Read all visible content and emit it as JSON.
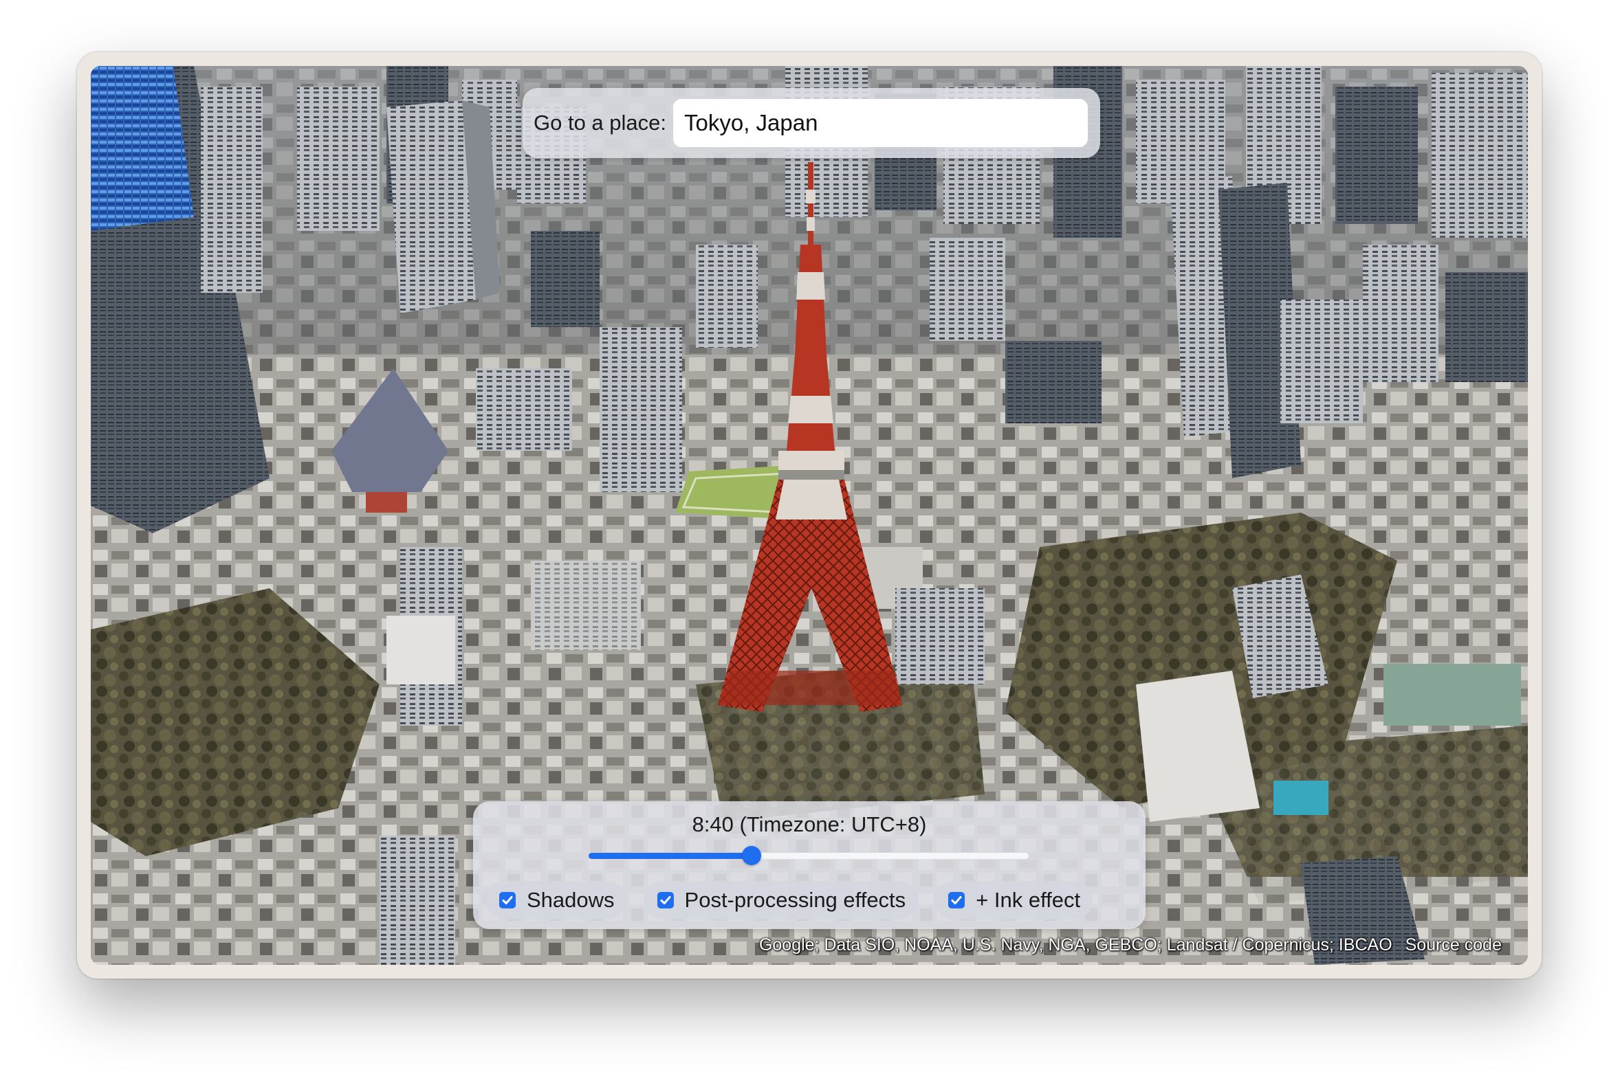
{
  "search": {
    "label": "Go to a place:",
    "value": "Tokyo, Japan"
  },
  "time": {
    "label": "8:40 (Timezone: UTC+8)",
    "slider_fraction": 0.37
  },
  "toggles": [
    {
      "label": "Shadows",
      "checked": true
    },
    {
      "label": "Post-processing effects",
      "checked": true
    },
    {
      "label": "+ Ink effect",
      "checked": true
    }
  ],
  "attribution": {
    "text": "Google; Data SIO, NOAA, U.S. Navy, NGA, GEBCO; Landsat / Copernicus; IBCAO",
    "source_link": "Source code"
  },
  "colors": {
    "accent": "#1f6ef0",
    "tower_red": "#c23a26",
    "tower_white": "#ede6df",
    "field_green": "#a7c464"
  }
}
